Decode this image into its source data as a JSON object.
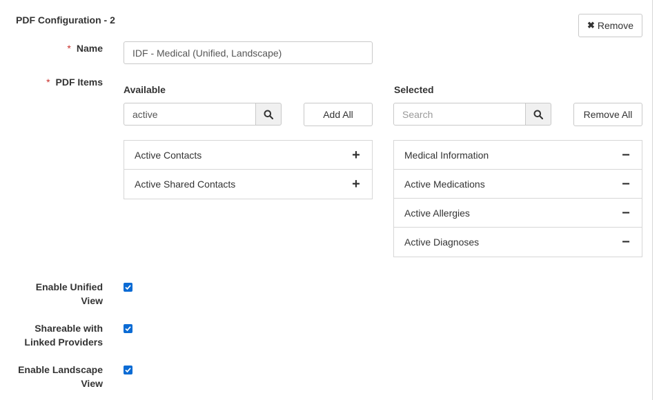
{
  "form": {
    "heading": "PDF Configuration - 2",
    "remove_button": {
      "icon": "close-icon",
      "label": "Remove"
    },
    "name": {
      "required_mark": "*",
      "label": "Name",
      "value": "IDF - Medical (Unified, Landscape)"
    },
    "pdf_items": {
      "required_mark": "*",
      "label": "PDF Items"
    }
  },
  "available": {
    "title": "Available",
    "search_value": "active",
    "search_placeholder": "",
    "add_all_label": "Add All",
    "items": [
      {
        "label": "Active Contacts",
        "action_icon": "plus-icon",
        "action_glyph": "+"
      },
      {
        "label": "Active Shared Contacts",
        "action_icon": "plus-icon",
        "action_glyph": "+"
      }
    ]
  },
  "selected": {
    "title": "Selected",
    "search_value": "",
    "search_placeholder": "Search",
    "remove_all_label": "Remove All",
    "items": [
      {
        "label": "Medical Information",
        "action_icon": "minus-icon",
        "action_glyph": "−"
      },
      {
        "label": "Active Medications",
        "action_icon": "minus-icon",
        "action_glyph": "−"
      },
      {
        "label": "Active Allergies",
        "action_icon": "minus-icon",
        "action_glyph": "−"
      },
      {
        "label": "Active Diagnoses",
        "action_icon": "minus-icon",
        "action_glyph": "−"
      }
    ]
  },
  "options": [
    {
      "label_line1": "Enable Unified",
      "label_line2": "View",
      "checked": true
    },
    {
      "label_line1": "Shareable with",
      "label_line2": "Linked Providers",
      "checked": true
    },
    {
      "label_line1": "Enable Landscape",
      "label_line2": "View",
      "checked": true
    }
  ],
  "colors": {
    "checkbox_accent": "#0b6bd4",
    "required_mark": "#c9302c",
    "border": "#c8c8c8"
  }
}
